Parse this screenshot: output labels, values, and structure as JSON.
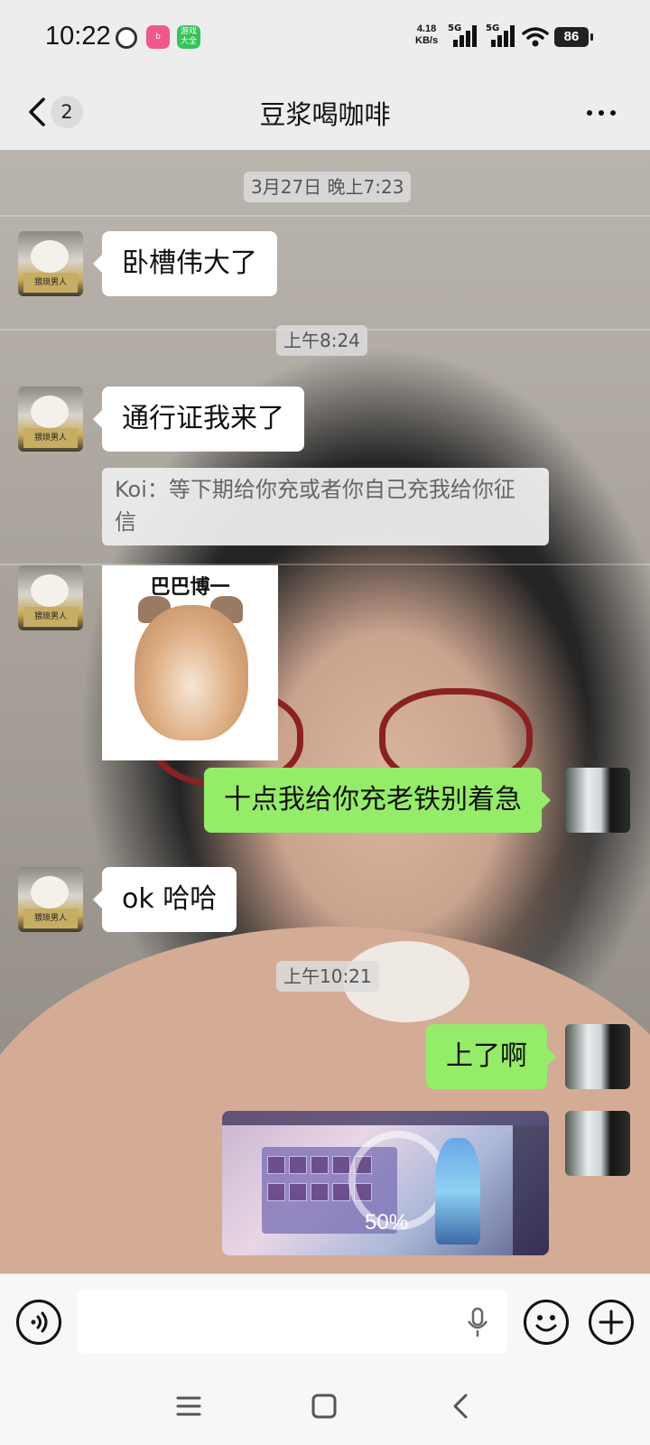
{
  "status_bar": {
    "time": "10:22",
    "net_speed_value": "4.18",
    "net_speed_unit": "KB/s",
    "sim1_label": "5G",
    "sim2_label": "5G",
    "battery": "86",
    "app_icons": [
      "clock-icon",
      "bilibili-icon",
      "game-center-icon"
    ],
    "app2_label": "游戏大全"
  },
  "header": {
    "back_count": "2",
    "title": "豆浆喝咖啡"
  },
  "chat": {
    "messages": [
      {
        "type": "timestamp",
        "text": "3月27日 晚上7:23"
      },
      {
        "type": "text",
        "side": "left",
        "text": "卧槽伟大了"
      },
      {
        "type": "timestamp",
        "text": "上午8:24"
      },
      {
        "type": "text",
        "side": "left",
        "text": "通行证我来了"
      },
      {
        "type": "quote",
        "text": "Koi：等下期给你充或者你自己充我给你征信"
      },
      {
        "type": "sticker",
        "side": "left",
        "caption": "巴巴博一"
      },
      {
        "type": "text",
        "side": "right",
        "text": "十点我给你充老铁别着急"
      },
      {
        "type": "text",
        "side": "left",
        "text": "ok 哈哈"
      },
      {
        "type": "timestamp",
        "text": "上午10:21"
      },
      {
        "type": "text",
        "side": "right",
        "text": "上了啊"
      },
      {
        "type": "image",
        "side": "right",
        "overlay_text": "50%"
      }
    ],
    "avatar_left_caption": "猥琐男人"
  },
  "input_bar": {
    "value": "",
    "placeholder": "",
    "icons": [
      "voice-toggle-icon",
      "microphone-icon",
      "emoji-icon",
      "plus-icon"
    ]
  },
  "system_nav": {
    "icons": [
      "menu-icon",
      "home-icon",
      "back-icon"
    ]
  },
  "colors": {
    "outgoing_bubble": "#95ec69",
    "incoming_bubble": "#ffffff",
    "background": "#ededed"
  }
}
